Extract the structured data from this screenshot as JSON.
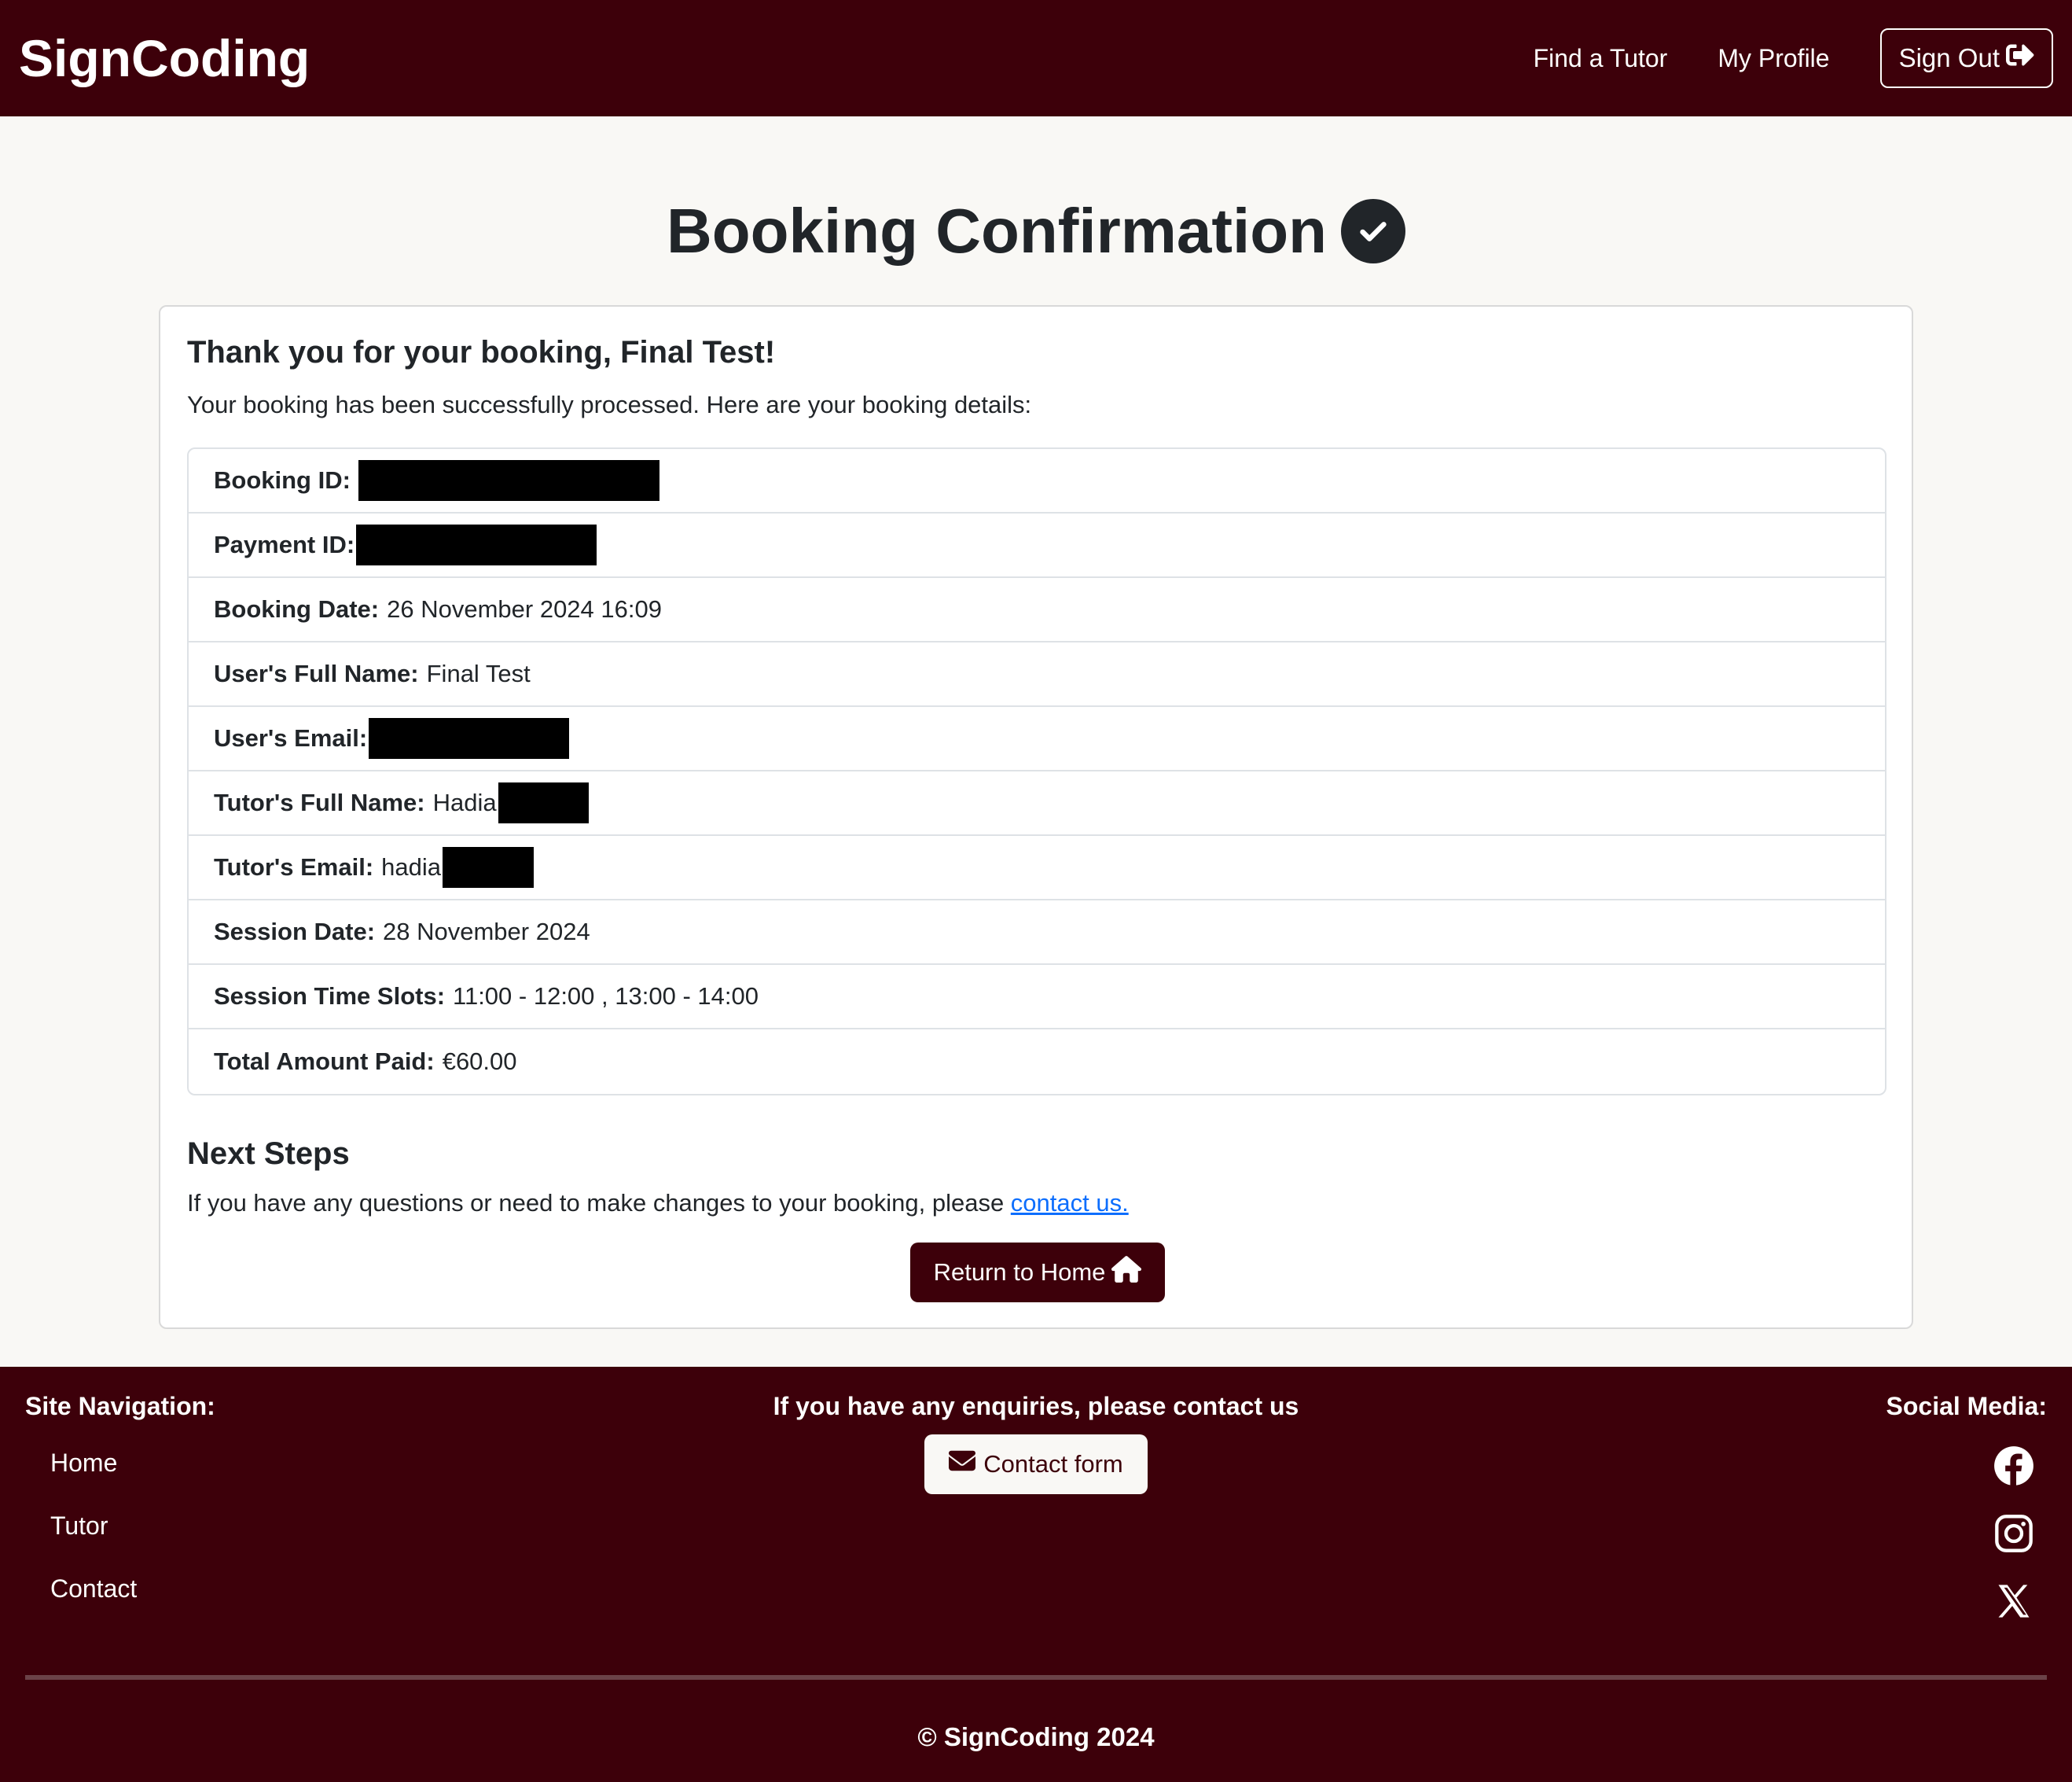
{
  "header": {
    "brand": "SignCoding",
    "nav": [
      "Find a Tutor",
      "My Profile"
    ],
    "sign_out": "Sign Out"
  },
  "page_title": "Booking Confirmation",
  "card": {
    "thanks": "Thank you for your booking, Final Test!",
    "intro": "Your booking has been successfully processed. Here are your booking details:",
    "details": [
      {
        "label": "Booking ID:",
        "value": ""
      },
      {
        "label": "Payment ID:",
        "value": ""
      },
      {
        "label": "Booking Date:",
        "value": "26 November 2024 16:09"
      },
      {
        "label": "User's Full Name:",
        "value": "Final Test"
      },
      {
        "label": "User's Email:",
        "value": ""
      },
      {
        "label": "Tutor's Full Name:",
        "value": "Hadia"
      },
      {
        "label": "Tutor's Email:",
        "value": "hadia"
      },
      {
        "label": "Session Date:",
        "value": "28 November 2024"
      },
      {
        "label": "Session Time Slots:",
        "value": "11:00 - 12:00 , 13:00 - 14:00"
      },
      {
        "label": "Total Amount Paid:",
        "value": "€60.00"
      }
    ],
    "next_steps_title": "Next Steps",
    "next_steps_text": "If you have any questions or need to make changes to your booking, please ",
    "contact_link": "contact us.",
    "return_button": "Return to Home"
  },
  "footer": {
    "nav_title": "Site Navigation:",
    "nav_links": [
      "Home",
      "Tutor",
      "Contact"
    ],
    "enquiries": "If you have any enquiries, please contact us",
    "contact_button": "Contact form",
    "social_title": "Social Media:",
    "social_icons": [
      "facebook-icon",
      "instagram-icon",
      "x-icon"
    ],
    "copyright": "© SignCoding 2024"
  },
  "colors": {
    "brand": "#3d000a",
    "background": "#f9f8f5",
    "link": "#0d6efd"
  }
}
